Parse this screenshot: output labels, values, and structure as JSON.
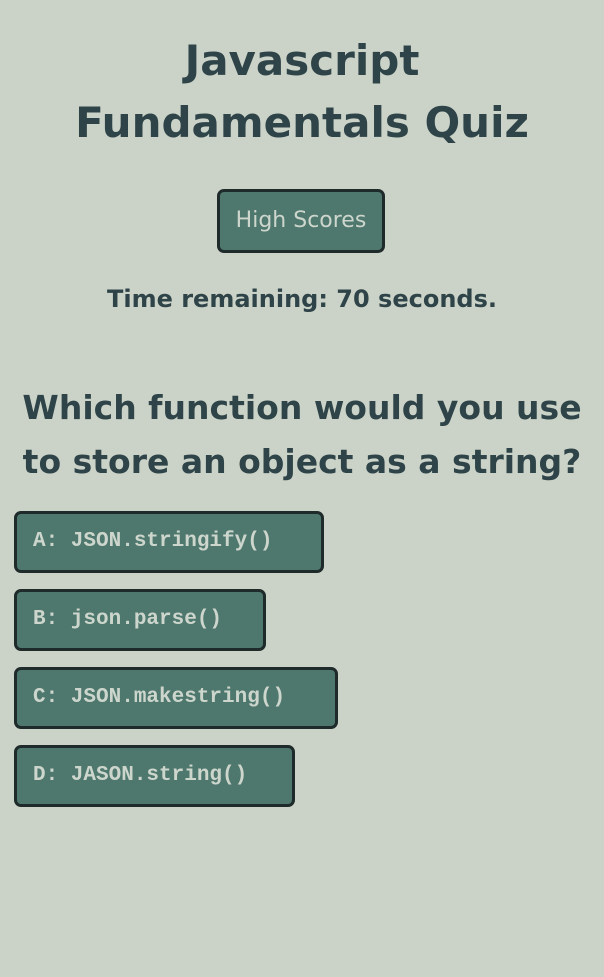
{
  "header": {
    "title_line1": "Javascript",
    "title_line2": "Fundamentals Quiz",
    "high_scores_label": "High Scores"
  },
  "timer": {
    "text": "Time remaining: 70 seconds."
  },
  "quiz": {
    "question_line1": "Which function would you use",
    "question_line2": "to store an object as a string?",
    "answers": [
      {
        "label": "A: JSON.stringify()"
      },
      {
        "label": "B: json.parse()"
      },
      {
        "label": "C: JSON.makestring()"
      },
      {
        "label": "D: JASON.string()"
      }
    ]
  },
  "colors": {
    "background": "#cbd3c8",
    "button": "#4e776d",
    "button_text": "#cdd6cd",
    "heading_text": "#2f4448",
    "border": "#1f2a2a"
  }
}
